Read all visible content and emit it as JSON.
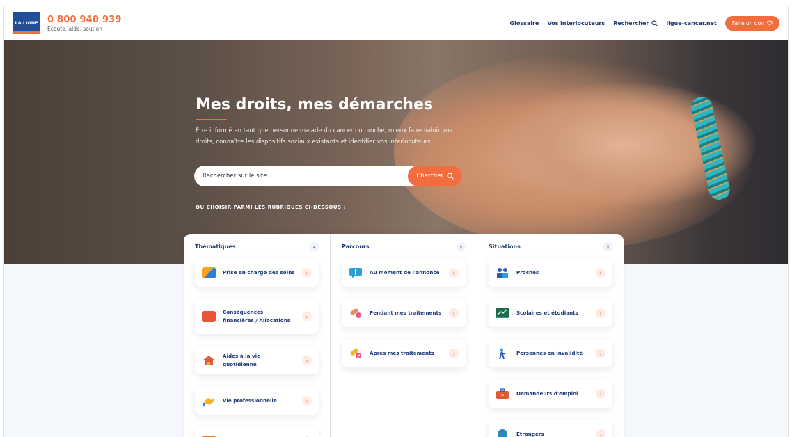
{
  "header": {
    "logo_text": "LA LIGUE",
    "phone": "0 800 940 939",
    "tagline": "Écoute, aide, soutien",
    "nav": [
      "Glossaire",
      "Vos interlocuteurs",
      "Rechercher",
      "ligue-cancer.net"
    ],
    "donate": "Faire un don",
    "accent": "#f26d3d",
    "brand": "#1f4e9b"
  },
  "hero": {
    "title": "Mes droits, mes démarches",
    "description": "Être informé en tant que personne malade du cancer ou proche, mieux faire valoir vos droits, connaître les dispositifs sociaux existants et identifier vos interlocuteurs.",
    "search_placeholder": "Rechercher sur le site...",
    "search_button": "Chercher",
    "choose_label": "OU CHOISIR PARMI LES RUBRIQUES CI-DESSOUS :"
  },
  "columns": [
    {
      "title": "Thématiques",
      "items": [
        {
          "label": "Prise en charge des soins",
          "icon": "card-icon",
          "color": "#f5a623"
        },
        {
          "label": "Conséquences financières / Allocations",
          "icon": "wallet-icon",
          "color": "#e8533a"
        },
        {
          "label": "Aides à la vie quotidienne",
          "icon": "house-icon",
          "color": "#e05a3a"
        },
        {
          "label": "Vie professionnelle",
          "icon": "handshake-icon",
          "color": "#f5b323"
        },
        {
          "label": "",
          "icon": "box-icon",
          "color": "#d9823b"
        }
      ]
    },
    {
      "title": "Parcours",
      "items": [
        {
          "label": "Au moment de l'annonce",
          "icon": "info-bubble-icon",
          "color": "#2b9fd8"
        },
        {
          "label": "Pendant mes traitements",
          "icon": "pills-icon",
          "color": "#f08a5d"
        },
        {
          "label": "Après mes traitements",
          "icon": "pills-done-icon",
          "color": "#e85d8a"
        }
      ]
    },
    {
      "title": "Situations",
      "items": [
        {
          "label": "Proches",
          "icon": "people-icon",
          "color": "#2a5db0"
        },
        {
          "label": "Scolaires et étudiants",
          "icon": "board-icon",
          "color": "#2e9e6a"
        },
        {
          "label": "Personnes en invalidité",
          "icon": "walker-icon",
          "color": "#2b9fd8"
        },
        {
          "label": "Demandeurs d'emploi",
          "icon": "briefcase-icon",
          "color": "#e05a3a"
        },
        {
          "label": "Étrangers",
          "icon": "globe-icon",
          "color": "#2b7fd8"
        }
      ]
    }
  ]
}
